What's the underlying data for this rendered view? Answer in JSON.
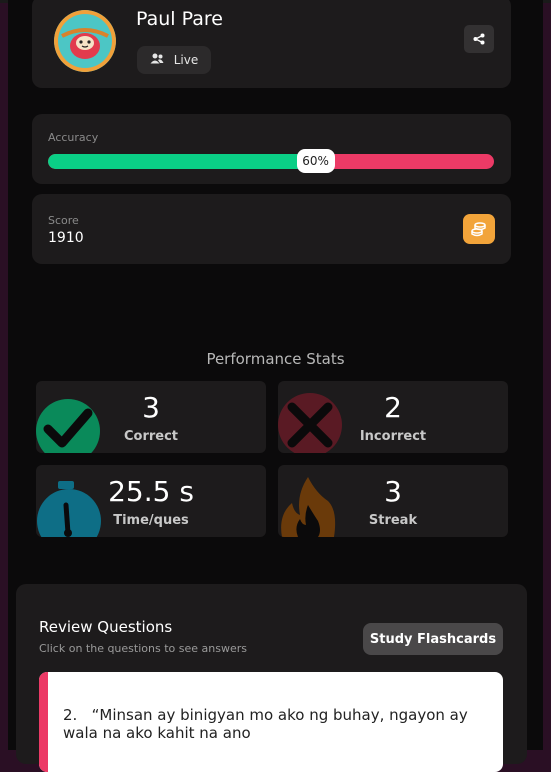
{
  "player": {
    "name": "Paul Pare",
    "status": "Live",
    "avatar_icon": "sloth-avatar-icon"
  },
  "accuracy": {
    "label": "Accuracy",
    "percent": 60,
    "percent_text": "60%",
    "colors": {
      "correct": "#0acf86",
      "incorrect": "#ec3a66"
    }
  },
  "score": {
    "label": "Score",
    "value": "1910",
    "icon": "coins-icon",
    "accent": "#f2a43a"
  },
  "performance": {
    "title": "Performance Stats",
    "stats": [
      {
        "value": "3",
        "caption": "Correct",
        "icon": "checkmark-icon",
        "color": "#0acf86"
      },
      {
        "value": "2",
        "caption": "Incorrect",
        "icon": "cross-icon",
        "color": "#ec3a66"
      },
      {
        "value": "25.5 s",
        "caption": "Time/ques",
        "icon": "stopwatch-icon",
        "color": "#1ba7c9"
      },
      {
        "value": "3",
        "caption": "Streak",
        "icon": "flame-icon",
        "color": "#f2a43a"
      }
    ]
  },
  "review": {
    "title": "Review Questions",
    "subtitle": "Click on the questions to see answers",
    "flashcards_label": "Study Flashcards",
    "questions": [
      {
        "text": "2.   “Minsan ay binigyan mo ako ng buhay, ngayon ay wala na ako kahit na ano"
      }
    ]
  }
}
